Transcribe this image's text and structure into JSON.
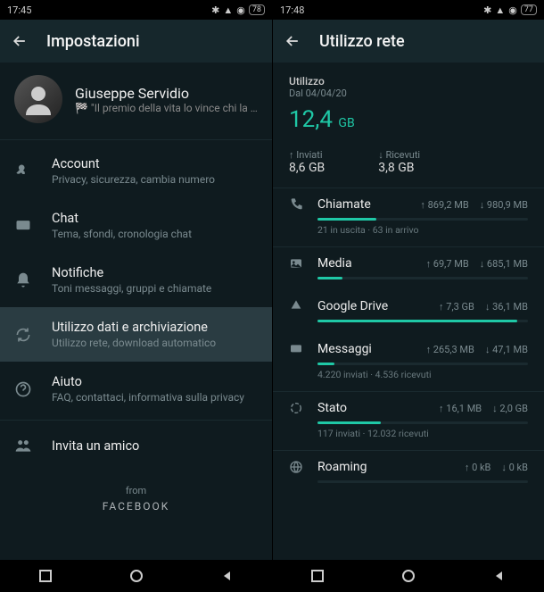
{
  "left": {
    "statusbar": {
      "time": "17:45",
      "battery": "78"
    },
    "header": {
      "title": "Impostazioni"
    },
    "profile": {
      "name": "Giuseppe Servidio",
      "status": "🏁 \"Il premio della vita lo vince chi la cors…"
    },
    "items": [
      {
        "icon": "key",
        "label": "Account",
        "sub": "Privacy, sicurezza, cambia numero"
      },
      {
        "icon": "chat",
        "label": "Chat",
        "sub": "Tema, sfondi, cronologia chat"
      },
      {
        "icon": "bell",
        "label": "Notifiche",
        "sub": "Toni messaggi, gruppi e chiamate"
      },
      {
        "icon": "sync",
        "label": "Utilizzo dati e archiviazione",
        "sub": "Utilizzo rete, download automatico"
      },
      {
        "icon": "help",
        "label": "Aiuto",
        "sub": "FAQ, contattaci, informativa sulla privacy"
      },
      {
        "icon": "people",
        "label": "Invita un amico",
        "sub": ""
      }
    ],
    "from": {
      "text": "from",
      "brand": "FACEBOOK"
    }
  },
  "right": {
    "statusbar": {
      "time": "17:48",
      "battery": "77"
    },
    "header": {
      "title": "Utilizzo rete"
    },
    "usage": {
      "label": "Utilizzo",
      "date": "Dal 04/04/20",
      "total_value": "12,4",
      "total_unit": "GB",
      "sent_label": "Inviati",
      "sent_value": "8,6 GB",
      "recv_label": "Ricevuti",
      "recv_value": "3,8 GB"
    },
    "cats": [
      {
        "icon": "phone",
        "name": "Chiamate",
        "up": "869,2 MB",
        "down": "980,9 MB",
        "fill": 28,
        "detail": "21 in uscita · 63 in arrivo",
        "sep": true
      },
      {
        "icon": "media",
        "name": "Media",
        "up": "69,7 MB",
        "down": "685,1 MB",
        "fill": 12,
        "detail": "",
        "sep": false
      },
      {
        "icon": "drive",
        "name": "Google Drive",
        "up": "7,3 GB",
        "down": "36,1 MB",
        "fill": 95,
        "detail": "",
        "sep": false
      },
      {
        "icon": "msg",
        "name": "Messaggi",
        "up": "265,3 MB",
        "down": "47,1 MB",
        "fill": 8,
        "detail": "4.220 inviati · 4.536 ricevuti",
        "sep": true
      },
      {
        "icon": "status",
        "name": "Stato",
        "up": "16,1 MB",
        "down": "2,0 GB",
        "fill": 30,
        "detail": "117 inviati · 12.032 ricevuti",
        "sep": true
      },
      {
        "icon": "globe",
        "name": "Roaming",
        "up": "0 kB",
        "down": "0 kB",
        "fill": 0,
        "detail": "",
        "sep": false
      }
    ]
  }
}
